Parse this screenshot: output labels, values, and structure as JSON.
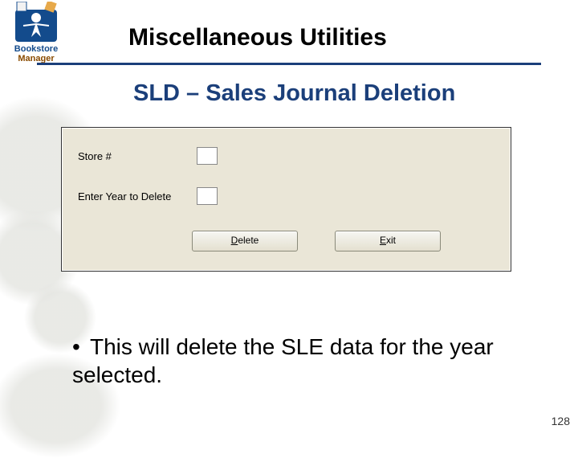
{
  "logo": {
    "line1": "Bookstore",
    "line2": "Manager"
  },
  "title": "Miscellaneous Utilities",
  "subtitle": "SLD – Sales Journal Deletion",
  "dialog": {
    "store_label": "Store #",
    "year_label": "Enter Year to Delete",
    "delete_btn": "elete",
    "exit_btn": "xit"
  },
  "bullet": "This will delete the SLE data for the year selected.",
  "page_number": "128"
}
